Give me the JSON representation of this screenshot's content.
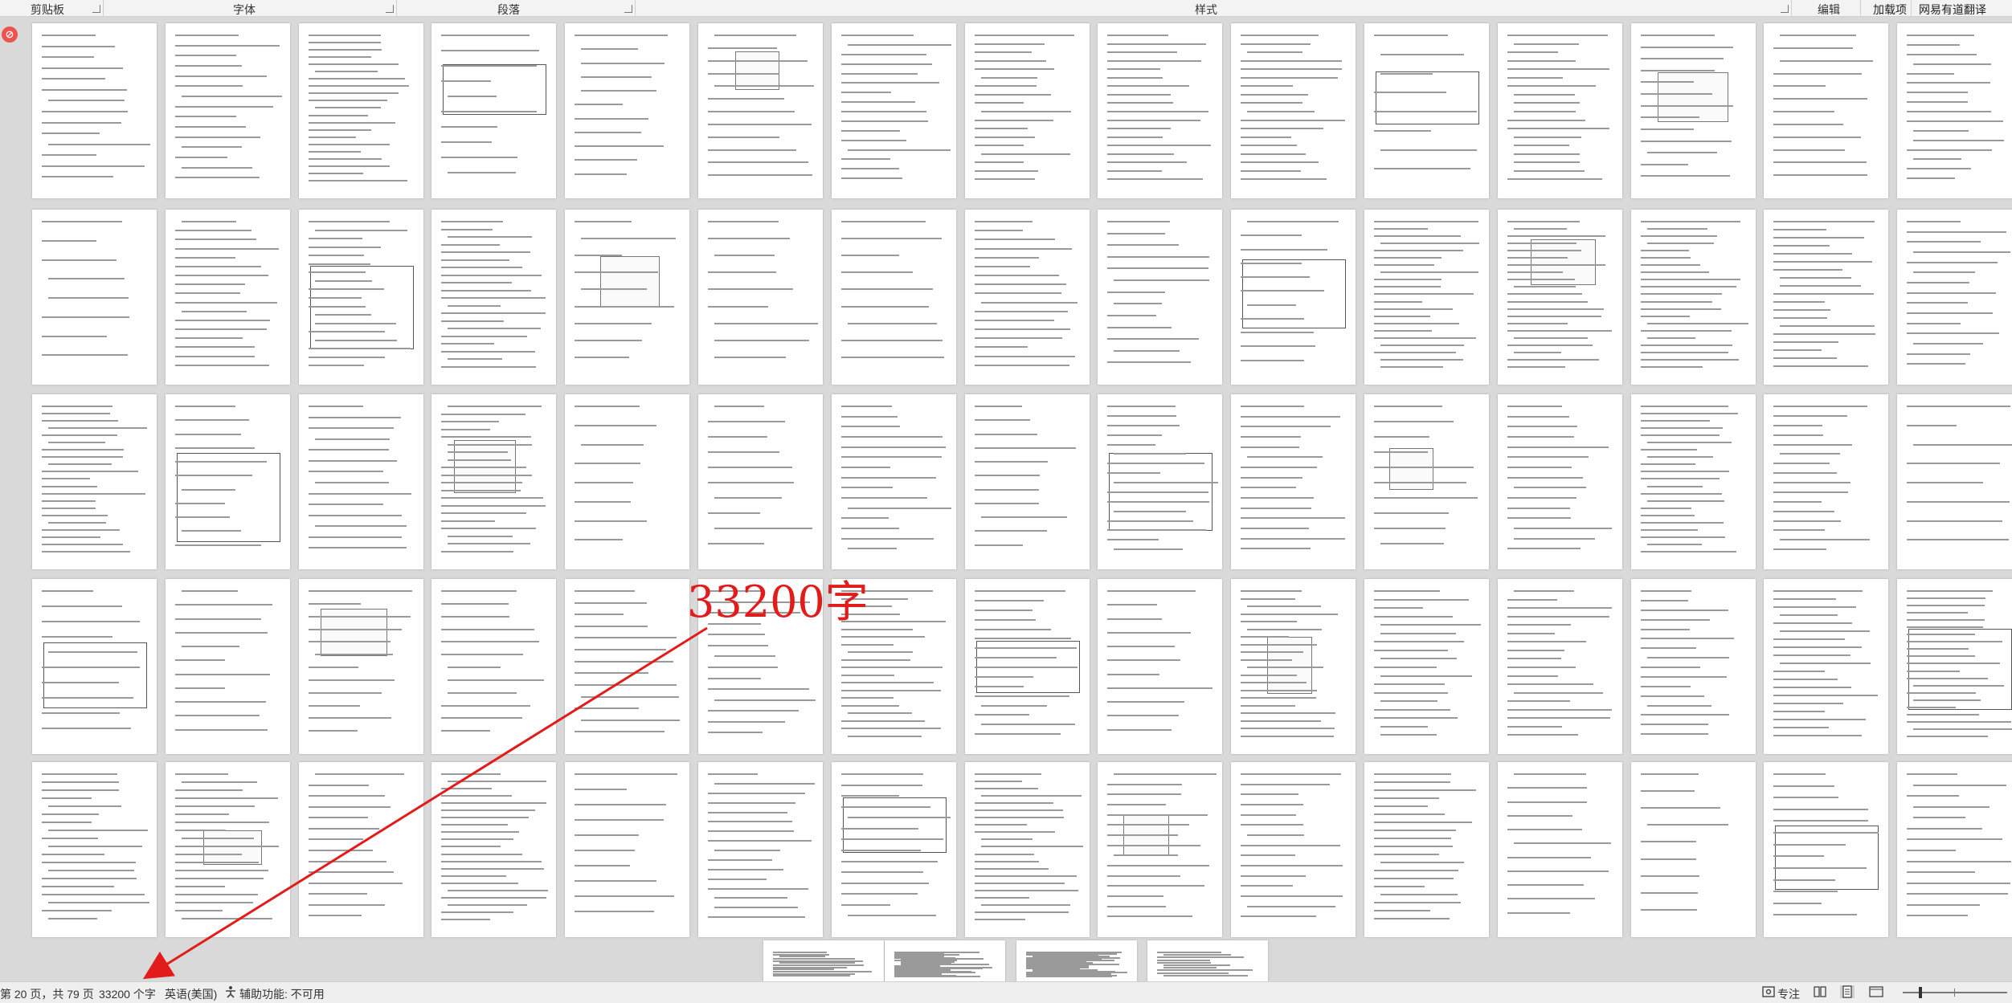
{
  "ribbon": {
    "groups": {
      "clipboard": "剪贴板",
      "font": "字体",
      "paragraph": "段落",
      "styles": "样式",
      "editing": "编辑"
    },
    "addins": "加载项",
    "youdao": "网易有道翻译"
  },
  "annotation": {
    "text": "33200字",
    "color": "#e21b1b"
  },
  "statusbar": {
    "page_info": "第 20 页，共 79 页",
    "word_count": "33200 个字",
    "language": "英语(美国)",
    "accessibility": "辅助功能: 不可用",
    "focus": "专注"
  },
  "icons": {
    "badge": "red-circle-badge-icon",
    "accessibility": "accessibility-icon",
    "focus": "focus-icon",
    "read_mode": "read-mode-icon",
    "print_layout": "print-layout-icon",
    "web_layout": "web-layout-icon",
    "zoom_slider": "zoom-slider"
  }
}
